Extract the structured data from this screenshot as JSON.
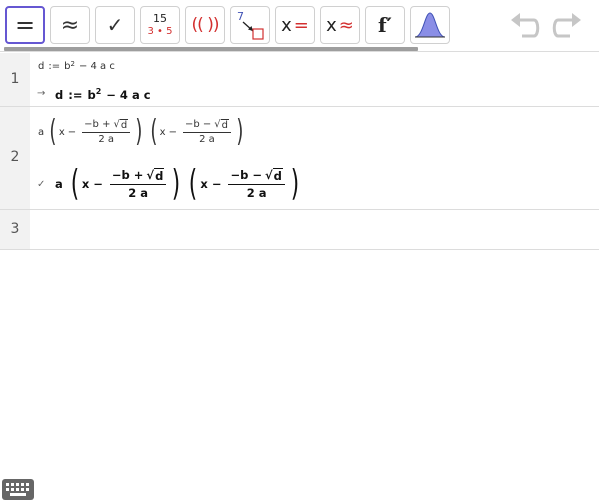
{
  "toolbar": {
    "evaluate": "=",
    "numeric": "≈",
    "keep_input": "✓",
    "factor_top": "15",
    "factor_bottom": "3 • 5",
    "expand": "(( ))",
    "substitute_num": "7",
    "solve_x": "x",
    "solve_eq": "=",
    "nsolve_x": "x",
    "nsolve_eq": "≈",
    "derivative": "f′"
  },
  "rows": [
    {
      "number": "1",
      "input": {
        "lhs": "d",
        "assign": ":=",
        "b": "b",
        "exp": "2",
        "rest": "− 4 a c"
      },
      "arrow": "→",
      "output": {
        "lhs": "d",
        "assign": ":=",
        "b": "b",
        "exp": "2",
        "rest": "− 4 a c"
      }
    },
    {
      "number": "2",
      "input": {
        "a": "a",
        "x": "x",
        "minus": "−",
        "num1a": "−b +",
        "sqrt_arg": "d",
        "num2a": "−b −",
        "den": "2 a"
      },
      "check": "✓",
      "output": {
        "a": "a",
        "x": "x",
        "minus": "−",
        "num1a": "−b +",
        "sqrt_arg": "d",
        "num2a": "−b −",
        "den": "2 a"
      }
    },
    {
      "number": "3"
    }
  ],
  "colors": {
    "accent": "#6557d2",
    "red": "#d32f2f",
    "blue": "#3f51b5",
    "distribution": "#8a8ee6"
  }
}
